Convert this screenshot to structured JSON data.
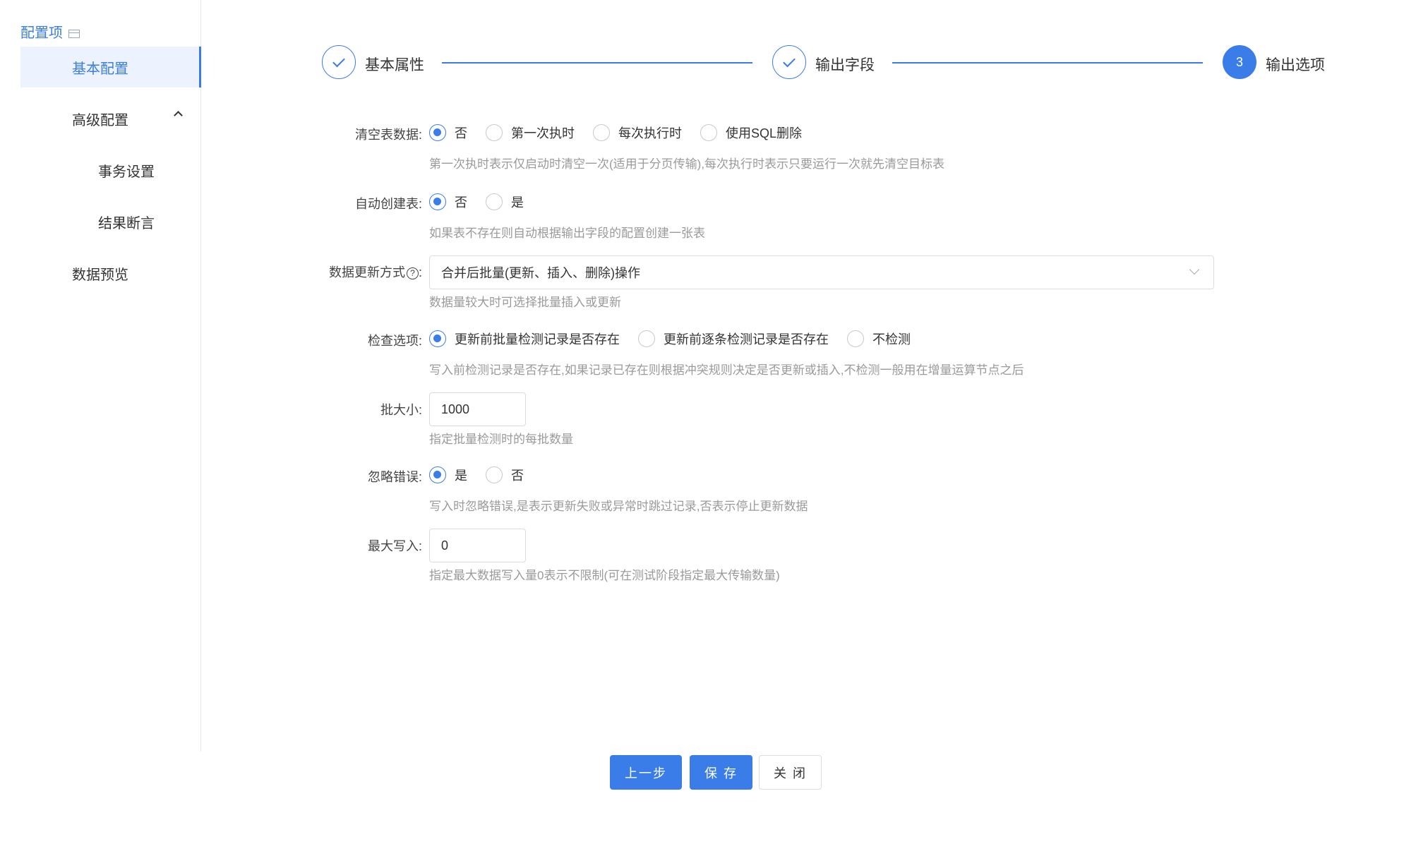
{
  "sidebar": {
    "title": "配置项",
    "items": [
      {
        "label": "基本配置"
      },
      {
        "label": "高级配置"
      },
      {
        "label": "事务设置"
      },
      {
        "label": "结果断言"
      },
      {
        "label": "数据预览"
      }
    ]
  },
  "steps": [
    {
      "label": "基本属性",
      "status": "done"
    },
    {
      "label": "输出字段",
      "status": "done"
    },
    {
      "label": "输出选项",
      "status": "current",
      "number": "3"
    }
  ],
  "form": {
    "clear_table": {
      "label": "清空表数据:",
      "options": [
        "否",
        "第一次执时",
        "每次执行时",
        "使用SQL删除"
      ],
      "selected": "否",
      "hint": "第一次执时表示仅启动时清空一次(适用于分页传输),每次执行时表示只要运行一次就先清空目标表"
    },
    "auto_create": {
      "label": "自动创建表:",
      "options": [
        "否",
        "是"
      ],
      "selected": "否",
      "hint": "如果表不存在则自动根据输出字段的配置创建一张表"
    },
    "update_mode": {
      "label": "数据更新方式",
      "label_suffix": ":",
      "help_icon": "?",
      "value": "合并后批量(更新、插入、删除)操作",
      "hint": "数据量较大时可选择批量插入或更新"
    },
    "check_option": {
      "label": "检查选项:",
      "options": [
        "更新前批量检测记录是否存在",
        "更新前逐条检测记录是否存在",
        "不检测"
      ],
      "selected": "更新前批量检测记录是否存在",
      "hint": "写入前检测记录是否存在,如果记录已存在则根据冲突规则决定是否更新或插入,不检测一般用在增量运算节点之后"
    },
    "batch_size": {
      "label": "批大小:",
      "value": "1000",
      "hint": "指定批量检测时的每批数量"
    },
    "ignore_errors": {
      "label": "忽略错误:",
      "options": [
        "是",
        "否"
      ],
      "selected": "是",
      "hint": "写入时忽略错误,是表示更新失败或异常时跳过记录,否表示停止更新数据"
    },
    "max_write": {
      "label": "最大写入:",
      "value": "0",
      "hint": "指定最大数据写入量0表示不限制(可在测试阶段指定最大传输数量)"
    }
  },
  "buttons": {
    "prev": "上一步",
    "save": "保 存",
    "close": "关 闭"
  },
  "colors": {
    "accent": "#3a7de8",
    "active_bg": "#ecf3ff",
    "hint": "#9a9a9a"
  }
}
